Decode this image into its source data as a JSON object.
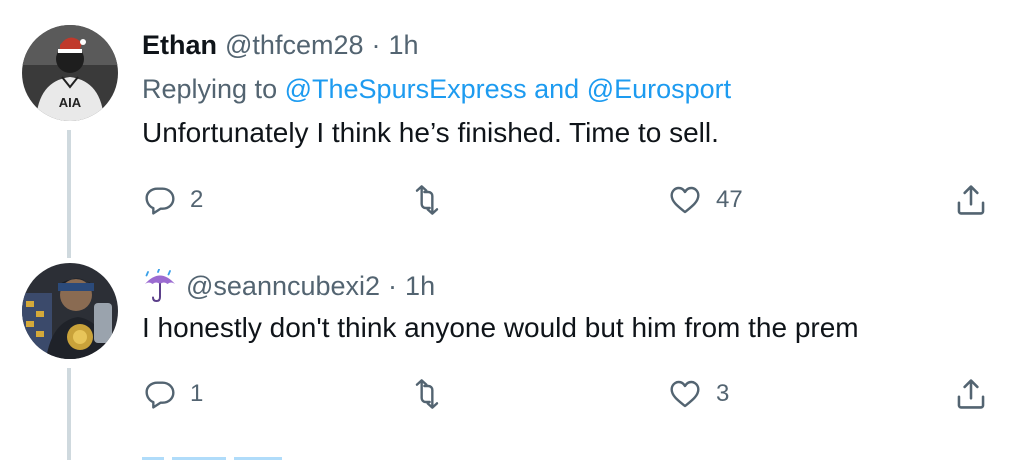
{
  "tweets": [
    {
      "name": "Ethan",
      "handle": "@thfcem28",
      "separator": "·",
      "time": "1h",
      "reply_prefix": "Replying to",
      "reply_mention_1": "@TheSpursExpress",
      "reply_and": "and",
      "reply_mention_2": "@Eurosport",
      "text": "Unfortunately I think he’s finished. Time to sell.",
      "avatar_text": "AIA",
      "reply_count": "2",
      "retweet_count": "",
      "like_count": "47"
    },
    {
      "name": "",
      "name_icon": "umbrella-with-rain-icon",
      "handle": "@seanncubexi2",
      "separator": "·",
      "time": "1h",
      "text": "I honestly don't think anyone would but him from the prem",
      "reply_count": "1",
      "retweet_count": "",
      "like_count": "3"
    }
  ],
  "icons": {
    "reply": "reply-bubble-icon",
    "retweet": "retweet-icon",
    "like": "heart-icon",
    "share": "share-icon"
  },
  "colors": {
    "link": "#1d9bf0",
    "secondary_text": "#536471",
    "primary_text": "#0f1419",
    "thread_line": "#cfd9de"
  }
}
